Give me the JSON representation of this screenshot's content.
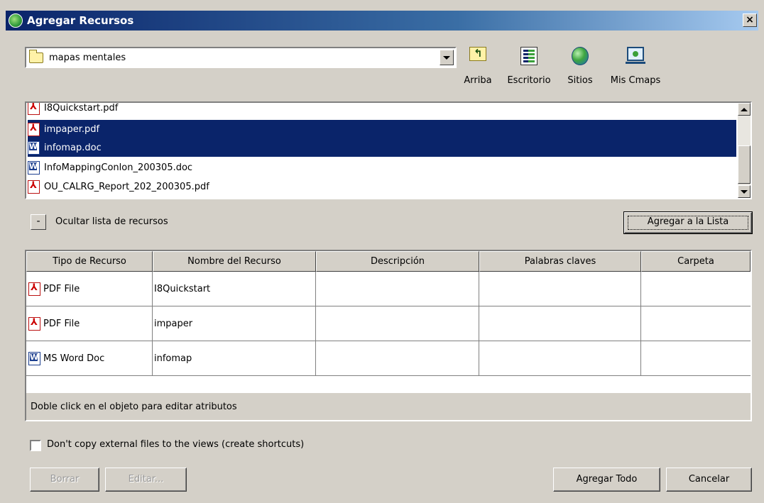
{
  "window": {
    "title": "Agregar Recursos",
    "close_label": "×"
  },
  "location": {
    "value": "mapas mentales"
  },
  "toolbar": [
    {
      "label": "Arriba",
      "icon": "folder-up-icon"
    },
    {
      "label": "Escritorio",
      "icon": "desktop-icon"
    },
    {
      "label": "Sitios",
      "icon": "globe-icon"
    },
    {
      "label": "Mis Cmaps",
      "icon": "computer-icon"
    }
  ],
  "files": [
    {
      "name": "I8Quickstart.pdf",
      "type": "pdf",
      "selected": false
    },
    {
      "name": "impaper.pdf",
      "type": "pdf",
      "selected": true
    },
    {
      "name": "infomap.doc",
      "type": "doc",
      "selected": true
    },
    {
      "name": "InfoMappingConlon_200305.doc",
      "type": "doc",
      "selected": false
    },
    {
      "name": "OU_CALRG_Report_202_200305.pdf",
      "type": "pdf",
      "selected": false
    }
  ],
  "toggle": {
    "symbol": "-",
    "label": "Ocultar lista de recursos"
  },
  "buttons": {
    "add_to_list": "Agregar a la Lista",
    "delete": "Borrar",
    "edit": "Editar...",
    "add_all": "Agregar Todo",
    "cancel": "Cancelar"
  },
  "table": {
    "columns": [
      "Tipo de Recurso",
      "Nombre del Recurso",
      "Descripción",
      "Palabras claves",
      "Carpeta"
    ],
    "rows": [
      {
        "type": "PDF File",
        "icon": "pdf",
        "name": "I8Quickstart",
        "description": "",
        "keywords": "",
        "folder": ""
      },
      {
        "type": "PDF File",
        "icon": "pdf",
        "name": "impaper",
        "description": "",
        "keywords": "",
        "folder": ""
      },
      {
        "type": "MS Word Doc",
        "icon": "doc",
        "name": "infomap",
        "description": "",
        "keywords": "",
        "folder": ""
      }
    ],
    "status": "Doble click en el objeto para editar atributos"
  },
  "options": {
    "shortcut_label": "Don't copy external files to the views (create shortcuts)",
    "shortcut_checked": false
  },
  "colors": {
    "selection": "#0a246a",
    "titlebar": "#0a246a",
    "face": "#d4d0c8"
  }
}
